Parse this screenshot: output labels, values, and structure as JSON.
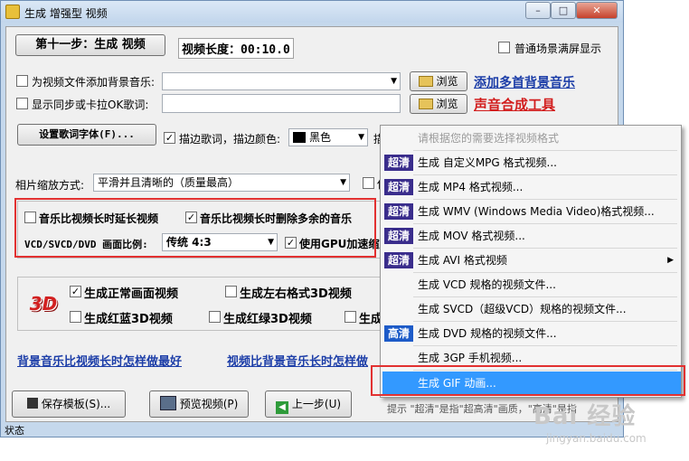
{
  "window": {
    "title": "生成 增强型 视频",
    "controls": {
      "minimize": "–",
      "maximize": "□",
      "close": "✕"
    }
  },
  "header": {
    "step_title": "第十一步：生成 视频",
    "duration": "视频长度：00:10.0",
    "widescreen_label": "普通场景满屏显示"
  },
  "audio": {
    "bg_music_label": "为视频文件添加背景音乐:",
    "bg_music_value": "",
    "browse_label": "浏览",
    "add_music_link": "添加多首背景音乐",
    "lyrics_label": "显示同步或卡拉OK歌词:",
    "lyrics_value": "",
    "voice_tool_link": "声音合成工具"
  },
  "lyrics_font": {
    "button_label": "设置歌词字体(F)...",
    "outline_label": "描边歌词，描边颜色:",
    "outline_checked": true,
    "color_value": "黑色",
    "color_hex": "#000000",
    "trailing_label": "描"
  },
  "photo_scale": {
    "label": "相片缩放方式:",
    "value": "平滑并且清晰的（质量最高）",
    "trailing_label": "使"
  },
  "options": {
    "extend_video_label": "音乐比视频长时延长视频",
    "extend_video_checked": false,
    "delete_music_label": "音乐比视频长时删除多余的音乐",
    "delete_music_checked": true,
    "aspect_label": "VCD/SVCD/DVD 画面比例:",
    "aspect_value": "传统 4:3",
    "gpu_label": "使用GPU加速缩放",
    "gpu_checked": true
  },
  "video3d": {
    "logo_text": "3D",
    "normal_label": "生成正常画面视频",
    "normal_checked": true,
    "lr3d_label": "生成左右格式3D视频",
    "lr3d_checked": false,
    "redblue_label": "生成红蓝3D视频",
    "redblue_checked": false,
    "redgreen_label": "生成红绿3D视频",
    "redgreen_checked": false,
    "other_label": "生成",
    "other_checked": false
  },
  "help_links": {
    "music_longer": "背景音乐比视频长时怎样做最好",
    "video_longer": "视频比背景音乐长时怎样做"
  },
  "footer": {
    "save_template": "保存模板(S)...",
    "preview": "预览视频(P)",
    "prev_step": "上一步(U)",
    "status": "状态"
  },
  "format_menu": {
    "header": "请根据您的需要选择视频格式",
    "items": [
      {
        "badge": "超清",
        "badge_kind": "ultra",
        "label": "生成 自定义MPG 格式视频..."
      },
      {
        "badge": "超清",
        "badge_kind": "ultra",
        "label": "生成 MP4 格式视频..."
      },
      {
        "badge": "超清",
        "badge_kind": "ultra",
        "label": "生成 WMV (Windows Media Video)格式视频..."
      },
      {
        "badge": "超清",
        "badge_kind": "ultra",
        "label": "生成 MOV 格式视频..."
      },
      {
        "badge": "超清",
        "badge_kind": "ultra",
        "label": "生成 AVI 格式视频",
        "submenu": "▶"
      },
      {
        "badge": "",
        "badge_kind": "",
        "label": "生成 VCD 规格的视频文件..."
      },
      {
        "badge": "",
        "badge_kind": "",
        "label": "生成 SVCD（超级VCD）规格的视频文件..."
      },
      {
        "badge": "高清",
        "badge_kind": "hd",
        "label": "生成 DVD 规格的视频文件..."
      },
      {
        "badge": "",
        "badge_kind": "",
        "label": "生成 3GP 手机视频..."
      },
      {
        "badge": "",
        "badge_kind": "",
        "label": "生成 GIF 动画..."
      }
    ],
    "selected_index": 9
  },
  "hint_text": "提示 \"超清\"是指\"超高清\"画质，\"高清\"是指",
  "watermark": {
    "main": "Bai 经验",
    "sub": "jingyan.baidu.com"
  }
}
